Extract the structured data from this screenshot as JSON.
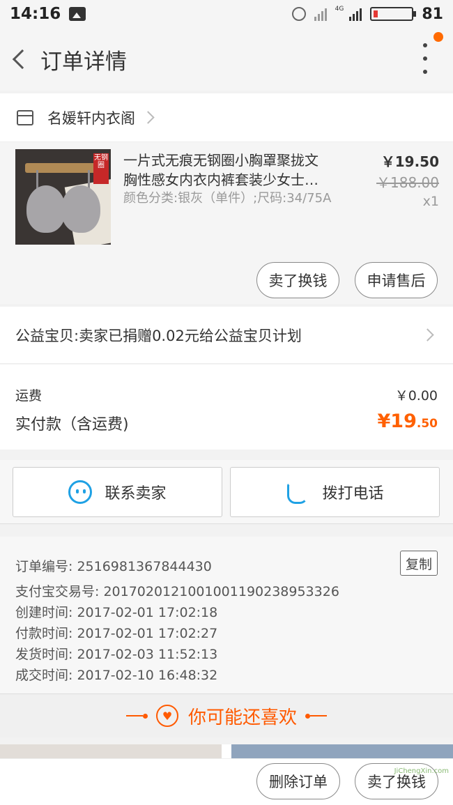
{
  "status_bar": {
    "time": "14:16",
    "battery": "81"
  },
  "header": {
    "title": "订单详情"
  },
  "shop": {
    "name": "名媛轩内衣阁"
  },
  "product": {
    "name_line1": "一片式无痕无钢圈小胸罩聚拢文",
    "name_line2": "胸性感女内衣内裤套装少女士…",
    "spec": "颜色分类:银灰（单件）;尺码:34/75A",
    "price": "￥19.50",
    "original_price": "￥188.00",
    "quantity": "x1",
    "thumb_tag": "无钢圈",
    "actions": {
      "exchange": "卖了换钱",
      "after_sale": "申请售后"
    }
  },
  "charity": {
    "text": "公益宝贝:卖家已捐赠0.02元给公益宝贝计划"
  },
  "fees": {
    "shipping_label": "运费",
    "shipping_value": "￥0.00",
    "paid_label": "实付款（含运费)",
    "paid_currency": "¥",
    "paid_integer": "19",
    "paid_decimal": ".50"
  },
  "contact": {
    "seller": "联系卖家",
    "call": "拨打电话"
  },
  "order_info": {
    "copy": "复制",
    "rows": [
      "订单编号: 2516981367844430",
      "支付宝交易号: 2017020121001001190238953326",
      "创建时间: 2017-02-01 17:02:18",
      "付款时间: 2017-02-01 17:02:27",
      "发货时间: 2017-02-03 11:52:13",
      "成交时间: 2017-02-10 16:48:32"
    ]
  },
  "recommend": {
    "title": "你可能还喜欢"
  },
  "bottom_bar": {
    "delete": "删除订单",
    "exchange": "卖了换钱"
  },
  "watermark": "JiChengXin.com",
  "colors": {
    "accent": "#ff6000",
    "link_icon": "#1fa1e4",
    "notify_dot": "#ff6a00"
  }
}
